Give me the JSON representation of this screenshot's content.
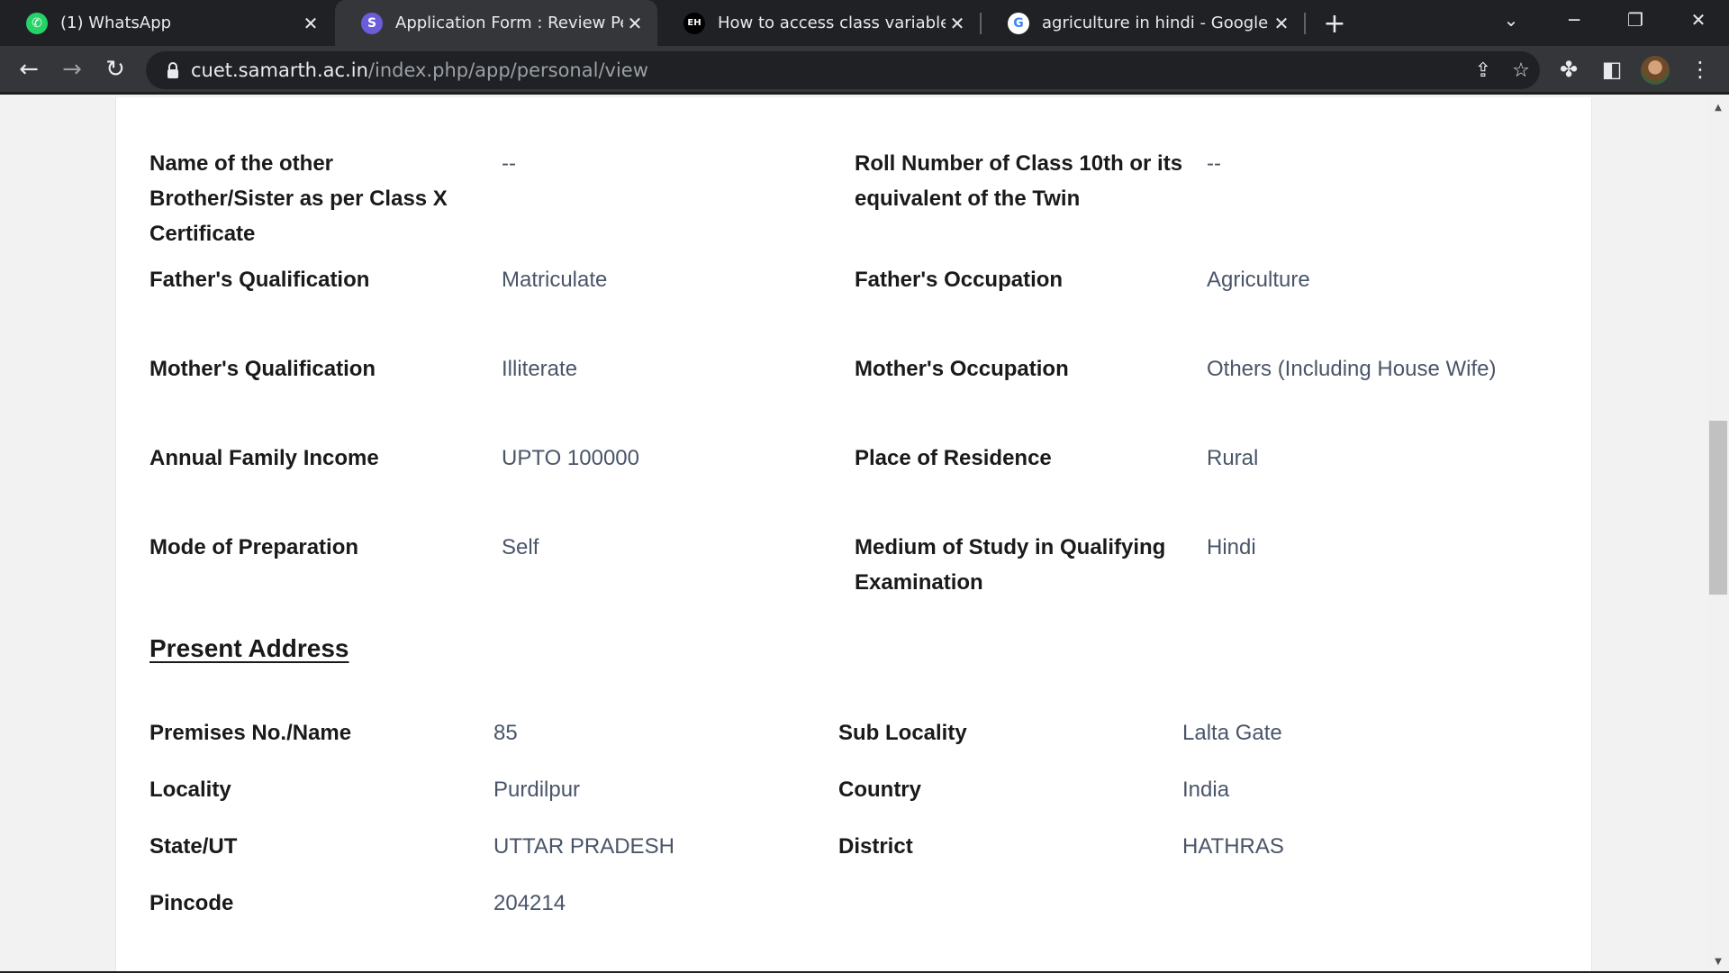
{
  "browser": {
    "tabs": [
      {
        "title": "(1) WhatsApp",
        "favicon": "whatsapp-icon",
        "active": false
      },
      {
        "title": "Application Form : Review Personal",
        "favicon": "samarth-icon",
        "active": true
      },
      {
        "title": "How to access class variable in Python",
        "favicon": "eh-icon",
        "active": false
      },
      {
        "title": "agriculture in hindi - Google Search",
        "favicon": "google-icon",
        "active": false
      }
    ],
    "url_host": "cuet.samarth.ac.in",
    "url_path": "/index.php/app/personal/view"
  },
  "personal_details": [
    {
      "label": "Name of the other Brother/Sister as per Class X Certificate",
      "value": "--"
    },
    {
      "label": "Roll Number of Class 10th or its equivalent of the Twin",
      "value": "--"
    },
    {
      "label": "Father's Qualification",
      "value": "Matriculate"
    },
    {
      "label": "Father's Occupation",
      "value": "Agriculture"
    },
    {
      "label": "Mother's Qualification",
      "value": "Illiterate"
    },
    {
      "label": "Mother's Occupation",
      "value": "Others (Including House Wife)"
    },
    {
      "label": "Annual Family Income",
      "value": "UPTO 100000"
    },
    {
      "label": "Place of Residence",
      "value": "Rural"
    },
    {
      "label": "Mode of Preparation",
      "value": "Self"
    },
    {
      "label": "Medium of Study in Qualifying Examination",
      "value": "Hindi"
    }
  ],
  "present_address": {
    "heading": "Present Address",
    "fields": [
      {
        "label": "Premises No./Name",
        "value": "85"
      },
      {
        "label": "Sub Locality",
        "value": "Lalta Gate"
      },
      {
        "label": "Locality",
        "value": "Purdilpur"
      },
      {
        "label": "Country",
        "value": "India"
      },
      {
        "label": "State/UT",
        "value": "UTTAR PRADESH"
      },
      {
        "label": "District",
        "value": "HATHRAS"
      },
      {
        "label": "Pincode",
        "value": "204214"
      }
    ]
  }
}
